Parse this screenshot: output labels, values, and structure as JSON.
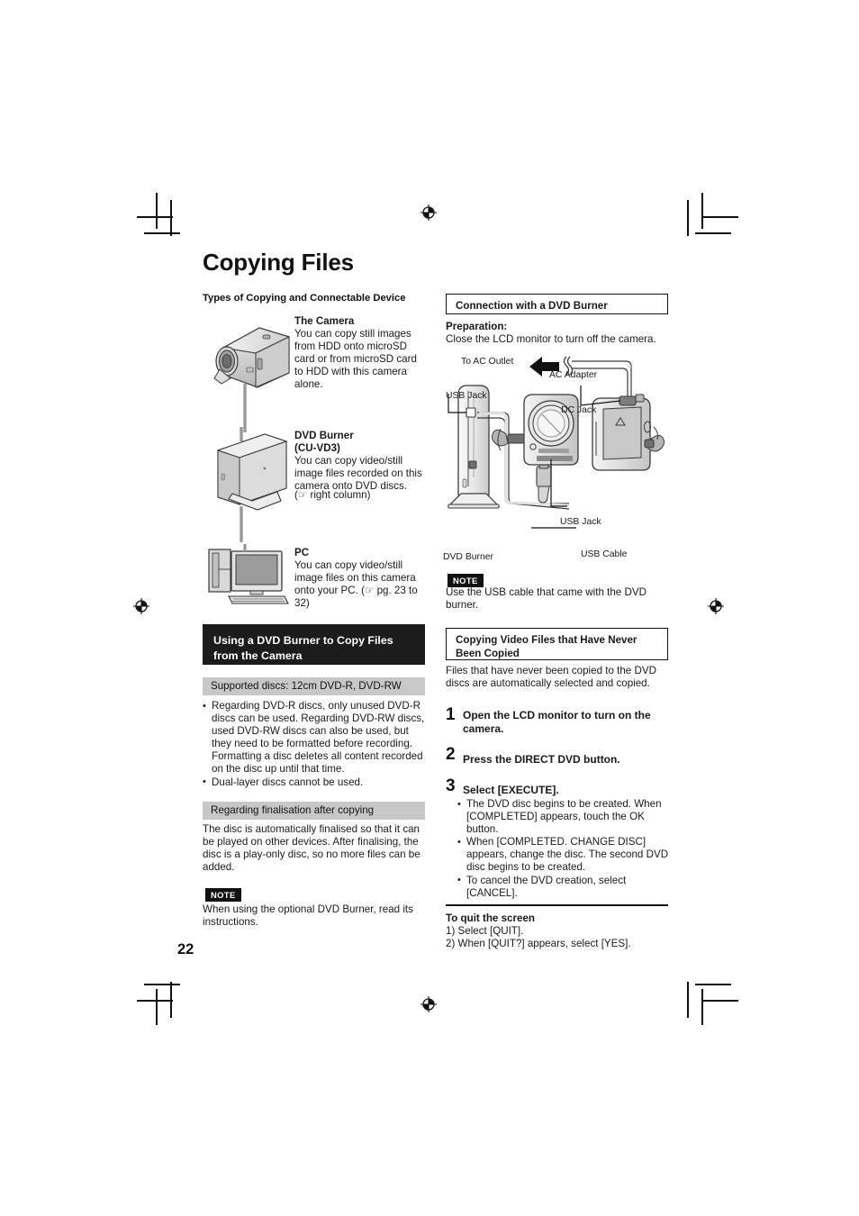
{
  "page": {
    "number": "22",
    "title": "Copying Files"
  },
  "left": {
    "section_subtitle": "Types of Copying and Connectable Device",
    "items": [
      {
        "heading": "The Camera",
        "body": "You can copy still images from HDD onto microSD card or from microSD card to HDD with this camera alone.",
        "icon": "camcorder-illustration"
      },
      {
        "heading_line1": "DVD Burner",
        "heading_line2": "(CU-VD3)",
        "body": "You can copy video/still image files recorded on this camera onto DVD discs.",
        "body_ref": "(☞ right column)",
        "icon": "dvd-burner-illustration"
      },
      {
        "heading": "PC",
        "body": "You can copy video/still image files on this camera onto your PC. (☞ pg. 23 to 32)",
        "icon": "pc-illustration"
      }
    ],
    "banner": {
      "line1": "Using a DVD Burner to Copy Files",
      "line2": "from the Camera"
    },
    "supported_bar": "Supported discs: 12cm DVD-R, DVD-RW",
    "supported_bullets": [
      "Regarding DVD-R discs, only unused DVD-R discs can be used. Regarding DVD-RW discs, used DVD-RW discs can also be used, but they need to be formatted before recording. Formatting a disc deletes all content recorded on the disc up until that time.",
      "Dual-layer discs cannot be used."
    ],
    "finalisation_bar": "Regarding finalisation after copying",
    "finalisation_body": "The disc is automatically finalised so that it can be played on other devices. After finalising, the disc is a play-only disc, so no more files can be added.",
    "note_tag": "NOTE",
    "note_body": "When using the optional DVD Burner, read its instructions."
  },
  "right": {
    "connection_heading": "Connection with a DVD Burner",
    "preparation_label": "Preparation:",
    "preparation_body": "Close the LCD monitor to turn off the camera.",
    "diagram_labels": {
      "to_ac_outlet": "To AC Outlet",
      "ac_adapter": "AC Adapter",
      "usb_jack_left": "USB Jack",
      "dc_jack": "DC Jack",
      "usb_jack_right": "USB Jack",
      "usb_cable": "USB Cable",
      "dvd_burner": "DVD Burner"
    },
    "note_tag": "NOTE",
    "note_body": "Use the USB cable that came with the DVD burner.",
    "copying_heading": {
      "line1": "Copying Video Files that Have Never",
      "line2": "Been Copied"
    },
    "copying_body": "Files that have never been copied to the DVD discs are automatically selected and copied.",
    "steps": [
      {
        "num": "1",
        "text": "Open the LCD monitor to turn on the camera."
      },
      {
        "num": "2",
        "text": "Press the DIRECT DVD button."
      },
      {
        "num": "3",
        "text": "Select [EXECUTE]."
      }
    ],
    "step3_bullets": [
      "The DVD disc begins to be created. When [COMPLETED] appears, touch the OK button.",
      "When [COMPLETED. CHANGE DISC] appears, change the disc. The second DVD disc begins to be created.",
      "To cancel the DVD creation, select [CANCEL]."
    ],
    "quit": {
      "heading": "To quit the screen",
      "lines": [
        "1) Select [QUIT].",
        "2) When [QUIT?] appears, select [YES]."
      ]
    }
  }
}
